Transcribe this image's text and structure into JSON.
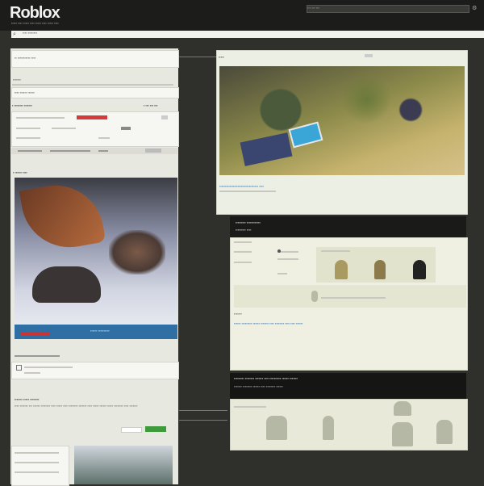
{
  "header": {
    "logo": "Roblox",
    "menu_text": "▪▪▪ ▪▪▪ ▪▪▪",
    "nav_text": "▪▪▪▪▪  ▪▪▪▪  ▪▪▪▪▪  ▪▪▪▪  ▪▪▪▪▪  ▪▪▪▪  ▪▪▪▪▪  ▪▪▪▪",
    "url_text": "▪▪▪▪ ▪▪▪▪▪▪▪▪"
  },
  "left": {
    "section1_title": "▪▪ ▪▪▪▪▪▪▪▪▪▪▪ ▪▪▪▪",
    "section1_line": "▪▪▪▪▪▪▪",
    "section2_line": "▪▪▪▪ ▪▪▪▪▪▪ ▪▪▪▪▪▪",
    "section3_title": "▪ ▪▪▪▪▪▪▪▪ ▪▪▪▪▪▪▪",
    "section3_right": "▪ ▪▪▪ ▪▪▪ ▪▪▪",
    "hero_title": "▪ ▪▪▪▪▪▪ ▪▪▪▪",
    "hero_caption": "▪▪▪▪▪▪ ▪▪▪▪▪▪▪▪▪▪",
    "bottom_title": "▪▪▪▪▪▪▪ ▪▪▪▪▪ ▪▪▪▪▪▪▪▪",
    "bottom_text": "▪▪▪▪ ▪▪▪▪▪▪▪ ▪▪▪ ▪▪▪▪▪▪ ▪▪▪▪▪▪▪▪ ▪▪▪▪ ▪▪▪▪▪ ▪▪▪▪ ▪▪▪▪▪▪▪▪ ▪▪▪▪▪▪▪ ▪▪▪▪ ▪▪▪▪▪ ▪▪▪▪▪▪ ▪▪▪▪▪ ▪▪▪▪▪▪▪▪ ▪▪▪▪ ▪▪▪▪▪▪▪"
  },
  "map_panel": {
    "title": "▪▪▪▪▪",
    "caption": "▪▪▪▪▪▪▪▪▪▪▪▪▪▪▪▪▪▪▪▪▪▪▪▪▪▪▪▪▪▪▪▪▪▪ ▪▪▪▪"
  },
  "avatar_panel": {
    "header": "▪▪▪▪▪▪▪▪▪ ▪▪▪▪▪▪▪▪▪▪▪▪",
    "subheader": "▪▪▪▪▪▪▪▪▪ ▪▪▪▪",
    "section_label": "▪▪▪▪▪▪▪",
    "text": "▪▪▪▪▪▪ ▪▪▪▪▪▪▪▪▪ ▪▪▪▪▪▪ ▪▪▪▪▪▪▪ ▪▪▪▪ ▪▪▪▪▪▪▪▪ ▪▪▪▪ ▪▪▪▪ ▪▪▪▪▪▪"
  },
  "bottom_panel": {
    "header": "▪▪▪▪▪▪▪▪▪ ▪▪▪▪▪▪▪▪ ▪▪▪▪▪▪▪ ▪▪▪▪ ▪▪▪▪▪▪▪▪▪▪ ▪▪▪▪▪▪ ▪▪▪▪▪▪▪",
    "sub": "▪▪▪▪▪▪▪ ▪▪▪▪▪▪▪▪ ▪▪▪▪▪▪ ▪▪▪▪ ▪▪▪▪▪▪▪▪ ▪▪▪▪▪▪"
  },
  "colors": {
    "accent_green": "#3f9a3b",
    "accent_red": "#d63b3b",
    "accent_blue": "#2f6fa3",
    "pool": "#3aa6d8"
  }
}
